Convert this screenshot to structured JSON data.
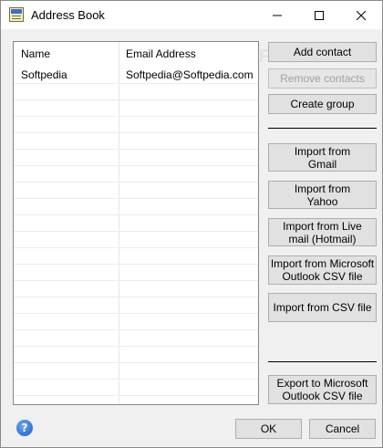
{
  "window": {
    "title": "Address Book"
  },
  "contacts_list": {
    "columns": [
      "Name",
      "Email Address"
    ],
    "rows": [
      {
        "name": "Softpedia",
        "email": "Softpedia@Softpedia.com"
      }
    ],
    "empty_rows": 19
  },
  "buttons": {
    "add_contact": "Add contact",
    "remove_contacts": "Remove contacts",
    "create_group": "Create group",
    "import_gmail": "Import from\nGmail",
    "import_yahoo": "Import from\nYahoo",
    "import_live": "Import from Live\nmail (Hotmail)",
    "import_outlook": "Import from Microsoft\nOutlook CSV file",
    "import_csv": "Import from CSV file",
    "export_outlook": "Export to Microsoft\nOutlook CSV file",
    "ok": "OK",
    "cancel": "Cancel"
  },
  "help_icon_text": "?",
  "watermark": "SOFTPEDIA"
}
